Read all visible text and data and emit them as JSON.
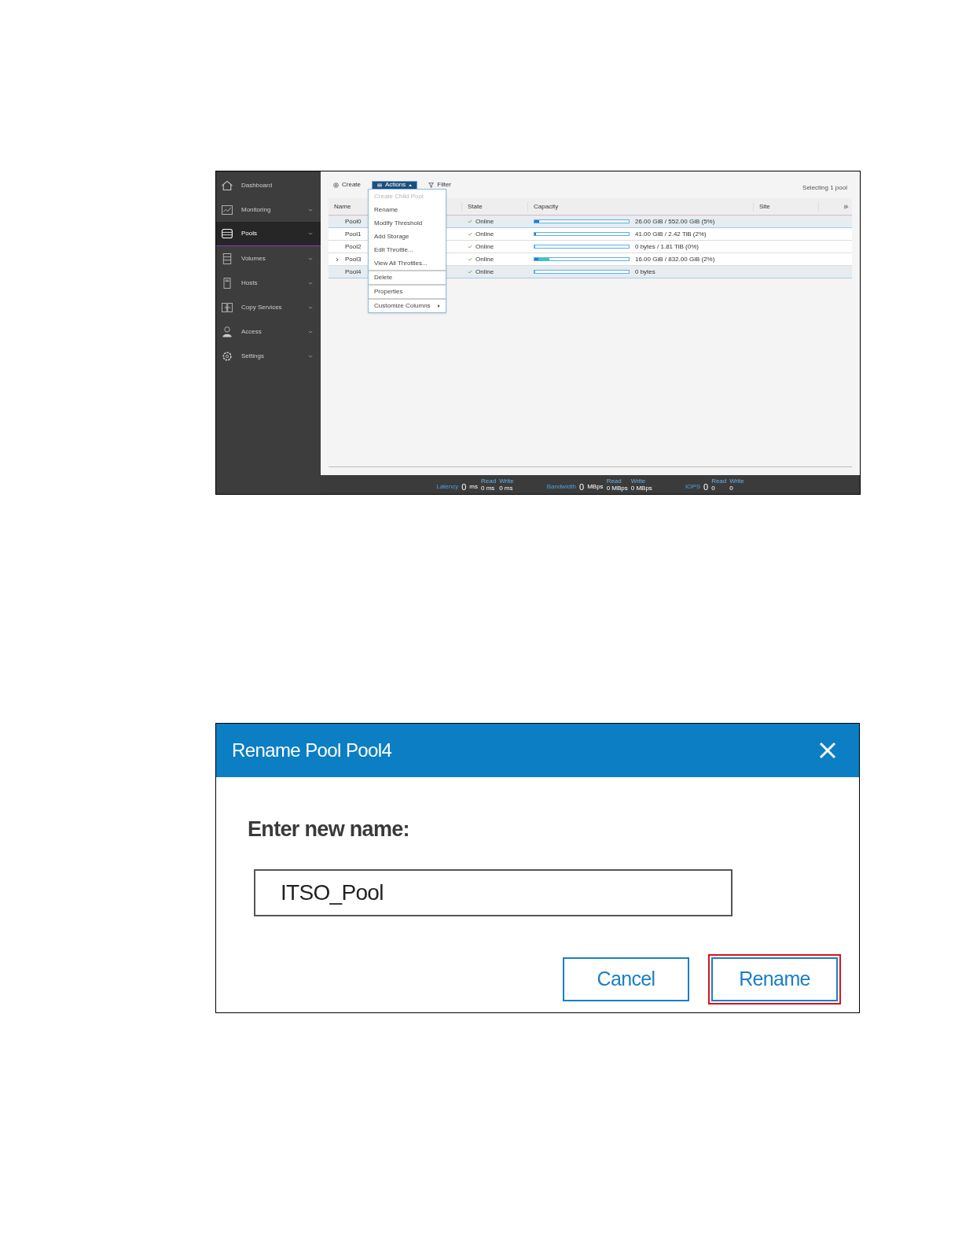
{
  "app": {
    "sidebar": {
      "items": [
        {
          "label": "Dashboard",
          "selected": false,
          "chevron": false
        },
        {
          "label": "Monitoring",
          "selected": false,
          "chevron": true
        },
        {
          "label": "Pools",
          "selected": true,
          "chevron": true
        },
        {
          "label": "Volumes",
          "selected": false,
          "chevron": true
        },
        {
          "label": "Hosts",
          "selected": false,
          "chevron": true
        },
        {
          "label": "Copy Services",
          "selected": false,
          "chevron": true
        },
        {
          "label": "Access",
          "selected": false,
          "chevron": true
        },
        {
          "label": "Settings",
          "selected": false,
          "chevron": true
        }
      ]
    },
    "toolbar": {
      "create": "Create",
      "actions": "Actions",
      "filter": "Filter",
      "selection_info": "Selecting 1 pool"
    },
    "table": {
      "columns": [
        "Name",
        "State",
        "Capacity",
        "Site"
      ],
      "rows": [
        {
          "name": "Pool0",
          "expandable": false,
          "state": "Online",
          "level": 0.05,
          "capacity": "26.00 GiB / 552.00 GiB (5%)",
          "selected": true
        },
        {
          "name": "Pool1",
          "expandable": false,
          "state": "Online",
          "level": 0.02,
          "capacity": "41.00 GiB / 2.42 TiB (2%)",
          "selected": false
        },
        {
          "name": "Pool2",
          "expandable": false,
          "state": "Online",
          "level": 0,
          "capacity": "0 bytes / 1.81 TiB (0%)",
          "selected": false
        },
        {
          "name": "Pool3",
          "expandable": true,
          "state": "Online",
          "level": 0.16,
          "capacity": "16.00 GiB / 832.00 GiB (2%)",
          "selected": false
        },
        {
          "name": "Pool4",
          "expandable": false,
          "state": "Online",
          "level": 0,
          "capacity": "0 bytes",
          "selected": true
        }
      ]
    },
    "actions_menu": [
      {
        "label": "Create Child Pool",
        "disabled": true,
        "separator_before": false,
        "submenu": false
      },
      {
        "label": "Rename",
        "disabled": false,
        "separator_before": false,
        "submenu": false
      },
      {
        "label": "Modify Threshold",
        "disabled": false,
        "separator_before": false,
        "submenu": false
      },
      {
        "label": "Add Storage",
        "disabled": false,
        "separator_before": false,
        "submenu": false
      },
      {
        "label": "Edit Throttle...",
        "disabled": false,
        "separator_before": false,
        "submenu": false
      },
      {
        "label": "View All Throttles...",
        "disabled": false,
        "separator_before": false,
        "submenu": false
      },
      {
        "label": "Delete",
        "disabled": false,
        "separator_before": true,
        "submenu": false
      },
      {
        "label": "Properties",
        "disabled": false,
        "separator_before": true,
        "submenu": false
      },
      {
        "label": "Customize Columns",
        "disabled": false,
        "separator_before": true,
        "submenu": true
      }
    ],
    "status_bar": [
      {
        "label": "Latency",
        "value": "0",
        "unit": "ms",
        "read_label": "Read",
        "read": "0 ms",
        "write_label": "Write",
        "write": "0 ms"
      },
      {
        "label": "Bandwidth",
        "value": "0",
        "unit": "MBps",
        "read_label": "Read",
        "read": "0 MBps",
        "write_label": "Write",
        "write": "0 MBps"
      },
      {
        "label": "IOPS",
        "value": "0",
        "read_label": "Read",
        "read": "0",
        "write_label": "Write",
        "write": "0"
      }
    ]
  },
  "dialog": {
    "title": "Rename Pool Pool4",
    "prompt": "Enter new name:",
    "value": "ITSO_Pool",
    "buttons": [
      {
        "label": "Cancel",
        "highlighted": false
      },
      {
        "label": "Rename",
        "highlighted": true
      }
    ]
  }
}
